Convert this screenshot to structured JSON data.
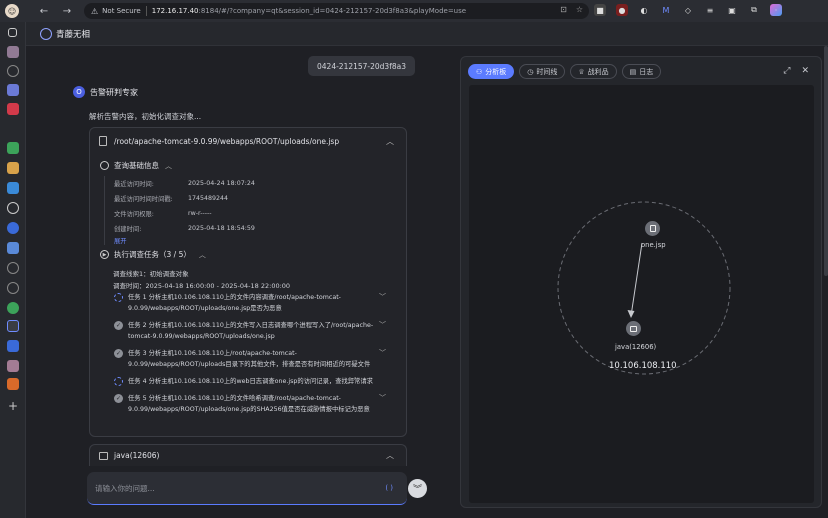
{
  "browser": {
    "url_warning": "Not Secure",
    "url_host": "172.16.17.40",
    "url_path": ":8184/#/?company=qt&session_id=0424-212157-20d3f8a3&playMode=use"
  },
  "app": {
    "title": "青藤无相"
  },
  "chat": {
    "session_id": "0424-212157-20d3f8a3",
    "agent_name": "告警研判专家",
    "agent_initial": "O",
    "intro": "解析告警内容，初始化调查对象...",
    "card": {
      "path": "/root/apache-tomcat-9.0.99/webapps/ROOT/uploads/one.jsp",
      "basic_section": "查询基础信息",
      "fields": [
        {
          "k": "最近访问时间:",
          "v": "2025-04-24 18:07:24"
        },
        {
          "k": "最近访问时间时间戳:",
          "v": "1745489244"
        },
        {
          "k": "文件访问权限:",
          "v": "rw-r-----"
        },
        {
          "k": "创建时间:",
          "v": "2025-04-18 18:54:59"
        }
      ],
      "expand": "展开",
      "task_section": "执行调查任务（3 / 5）",
      "plan_line1": "调查线索1：初始调查对象",
      "plan_line2": "调查时间：2025-04-18 16:00:00 - 2025-04-18 22:00:00",
      "tasks": [
        {
          "status": "running",
          "text": "任务 1 分析主机10.106.108.110上的文件内容调查/root/apache-tomcat-9.0.99/webapps/ROOT/uploads/one.jsp是否为恶意"
        },
        {
          "status": "done",
          "text": "任务 2 分析主机10.106.108.110上的文件写入日志调查哪个进程写入了/root/apache-tomcat-9.0.99/webapps/ROOT/uploads/one.jsp"
        },
        {
          "status": "done",
          "text": "任务 3 分析主机10.106.108.110上/root/apache-tomcat-9.0.99/webapps/ROOT/uploads目录下的其他文件，排查是否有时间相近的可疑文件"
        },
        {
          "status": "running",
          "text": "任务 4 分析主机10.106.108.110上的web日志调查one.jsp的访问记录，查找异常请求"
        },
        {
          "status": "done",
          "text": "任务 5 分析主机10.106.108.110上的文件哈希调查/root/apache-tomcat-9.0.99/webapps/ROOT/uploads/one.jsp的SHA256值是否在威胁情报中标记为恶意"
        }
      ]
    },
    "card2_title": "java(12606)",
    "input_placeholder": "请输入你的问题...",
    "input_tool": "( )"
  },
  "panel": {
    "tabs": [
      "分析板",
      "时间线",
      "战利品",
      "日志"
    ],
    "graph": {
      "file_node": "one.jsp",
      "process_node": "java(12606)",
      "host_ip": "10.106.108.110"
    }
  }
}
